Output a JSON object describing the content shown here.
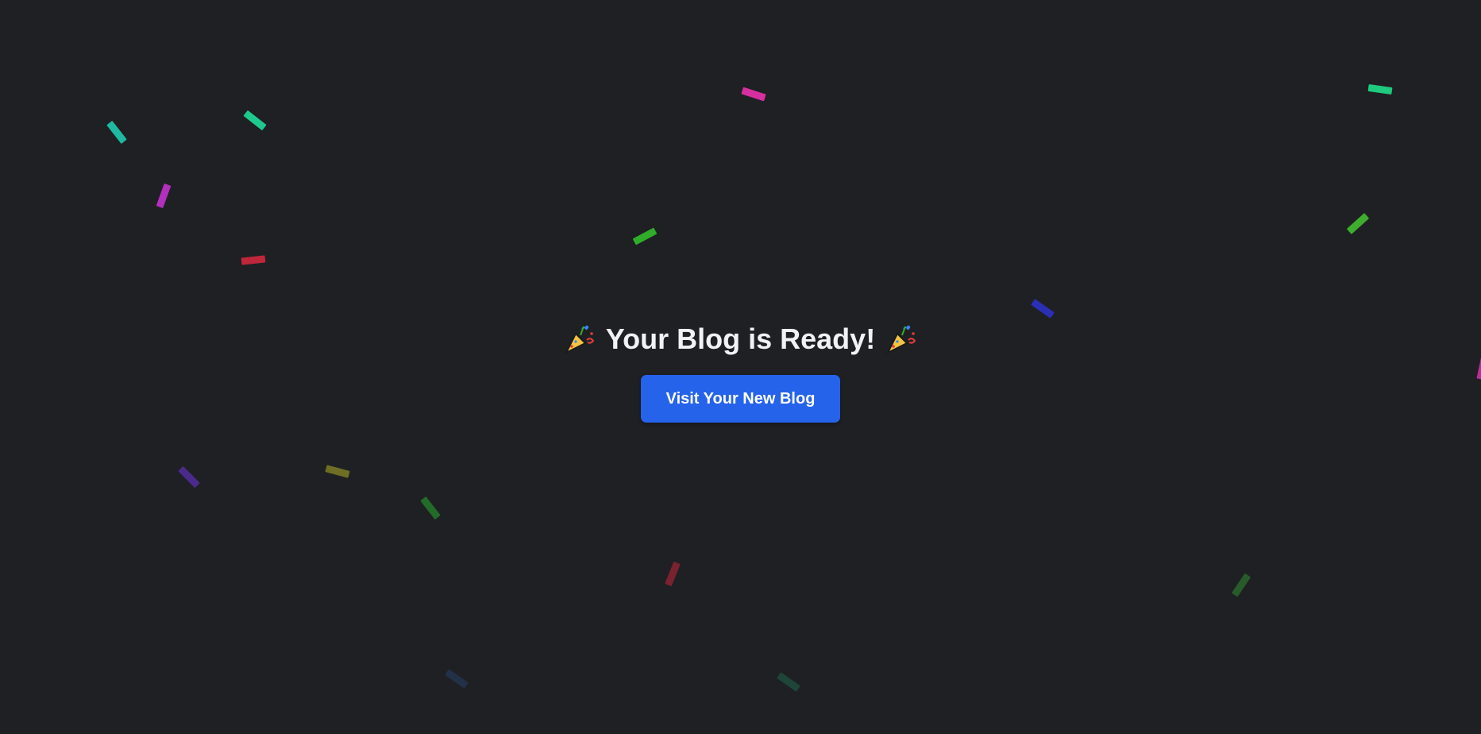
{
  "page": {
    "background": "#1f2023",
    "headline": "Your Blog is Ready!",
    "headline_icon": "party-popper-icon",
    "button_label": "Visit Your New Blog",
    "button_color": "#2563eb"
  },
  "confetti_colors": [
    "#1fb8a0",
    "#1ec98d",
    "#d62fa0",
    "#1fc97e",
    "#b32fbd",
    "#2fae2a",
    "#3fae2f",
    "#c0263a",
    "#2a2fb5",
    "#b82f9a",
    "#4a2a8a",
    "#6e6f24",
    "#226b2a",
    "#7a2230",
    "#275b2a",
    "#223048",
    "#1f4538"
  ]
}
